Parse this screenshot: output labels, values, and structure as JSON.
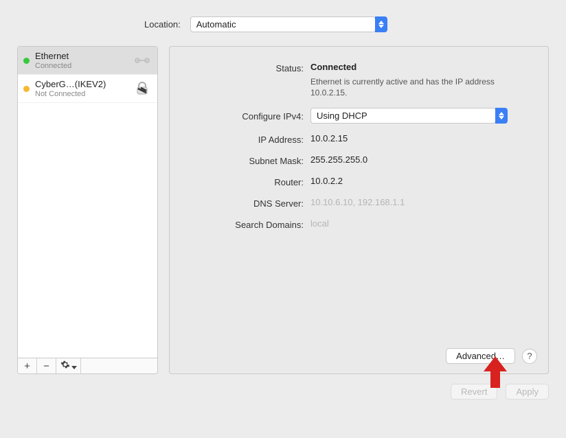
{
  "location": {
    "label": "Location:",
    "selected": "Automatic"
  },
  "sidebar": {
    "interfaces": [
      {
        "name": "Ethernet",
        "status": "Connected",
        "dot": "green",
        "selected": true,
        "icon": "ethernet"
      },
      {
        "name": "CyberG…(IKEV2)",
        "status": "Not Connected",
        "dot": "orange",
        "selected": false,
        "icon": "lock"
      }
    ],
    "footer": {
      "add": "+",
      "remove": "−"
    }
  },
  "detail": {
    "status_label": "Status:",
    "status_value": "Connected",
    "status_desc": "Ethernet is currently active and has the IP address 10.0.2.15.",
    "configure_ipv4_label": "Configure IPv4:",
    "configure_ipv4_value": "Using DHCP",
    "ip_label": "IP Address:",
    "ip_value": "10.0.2.15",
    "subnet_label": "Subnet Mask:",
    "subnet_value": "255.255.255.0",
    "router_label": "Router:",
    "router_value": "10.0.2.2",
    "dns_label": "DNS Server:",
    "dns_value": "10.10.6.10, 192.168.1.1",
    "search_label": "Search Domains:",
    "search_value": "local",
    "advanced": "Advanced…",
    "help": "?"
  },
  "bottom": {
    "revert": "Revert",
    "apply": "Apply"
  }
}
